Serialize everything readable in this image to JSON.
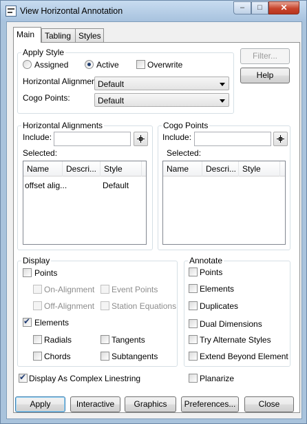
{
  "window": {
    "title": "View Horizontal Annotation",
    "minimize_glyph": "‒",
    "maximize_glyph": "□",
    "close_glyph": "✕"
  },
  "tabs": [
    {
      "label": "Main",
      "selected": true
    },
    {
      "label": "Tabling",
      "selected": false
    },
    {
      "label": "Styles",
      "selected": false
    }
  ],
  "apply_style": {
    "title": "Apply Style",
    "assigned_label": "Assigned",
    "active_label": "Active",
    "overwrite_label": "Overwrite",
    "selected_mode": "Active",
    "overwrite_checked": false,
    "horizontal_alignment_label": "Horizontal Alignment:",
    "horizontal_alignment_value": "Default",
    "cogo_points_label": "Cogo Points:",
    "cogo_points_value": "Default"
  },
  "side_buttons": {
    "filter": "Filter...",
    "help": "Help"
  },
  "horizontal_alignments": {
    "title": "Horizontal Alignments",
    "include_label": "Include:",
    "include_value": "",
    "selected_label": "Selected:",
    "columns": [
      "Name",
      "Descri...",
      "Style"
    ],
    "rows": [
      {
        "name": "offset alig...",
        "description": "",
        "style": "Default"
      }
    ]
  },
  "cogo_points": {
    "title": "Cogo Points",
    "include_label": "Include:",
    "include_value": "",
    "selected_label": "Selected:",
    "columns": [
      "Name",
      "Descri...",
      "Style"
    ],
    "rows": []
  },
  "display": {
    "title": "Display",
    "points": {
      "label": "Points",
      "checked": false
    },
    "on_alignment": {
      "label": "On-Alignment",
      "checked": false,
      "enabled": false
    },
    "event_points": {
      "label": "Event Points",
      "checked": false,
      "enabled": false
    },
    "off_alignment": {
      "label": "Off-Alignment",
      "checked": false,
      "enabled": false
    },
    "station_equations": {
      "label": "Station Equations",
      "checked": false,
      "enabled": false
    },
    "elements": {
      "label": "Elements",
      "checked": true
    },
    "radials": {
      "label": "Radials",
      "checked": false
    },
    "tangents": {
      "label": "Tangents",
      "checked": false
    },
    "chords": {
      "label": "Chords",
      "checked": false
    },
    "subtangents": {
      "label": "Subtangents",
      "checked": false
    },
    "complex_linestring": {
      "label": "Display As Complex Linestring",
      "checked": true
    }
  },
  "annotate": {
    "title": "Annotate",
    "points": {
      "label": "Points",
      "checked": false
    },
    "elements": {
      "label": "Elements",
      "checked": false
    },
    "duplicates": {
      "label": "Duplicates",
      "checked": false
    },
    "dual_dimensions": {
      "label": "Dual Dimensions",
      "checked": false
    },
    "try_alternate_styles": {
      "label": "Try Alternate Styles",
      "checked": false
    },
    "extend_beyond_element": {
      "label": "Extend Beyond Element",
      "checked": false
    },
    "planarize": {
      "label": "Planarize",
      "checked": false
    }
  },
  "footer_buttons": {
    "apply": "Apply",
    "interactive": "Interactive",
    "graphics": "Graphics",
    "preferences": "Preferences...",
    "close": "Close"
  },
  "checkmark_glyph": "✔"
}
